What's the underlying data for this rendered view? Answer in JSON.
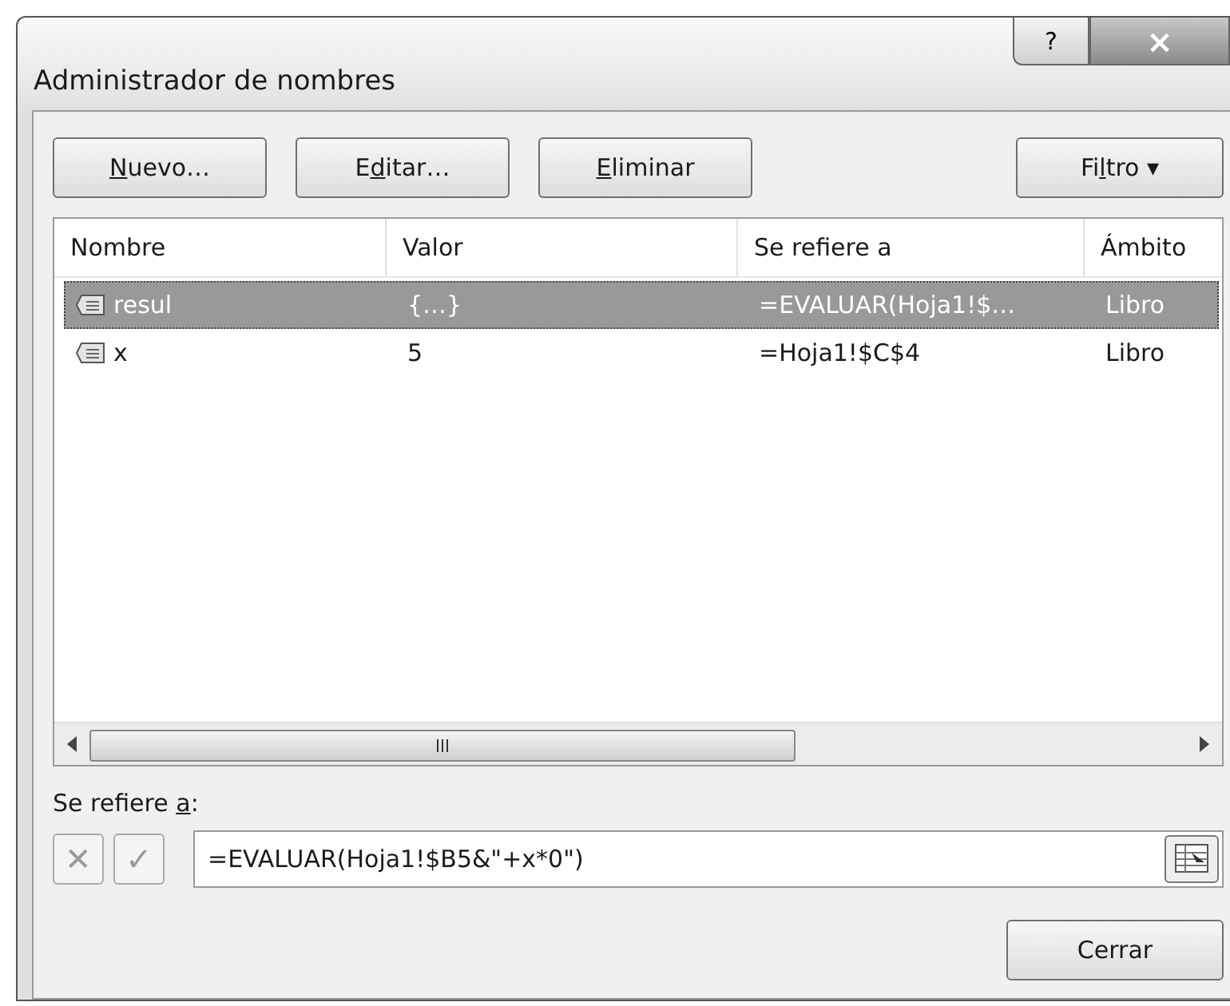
{
  "window": {
    "title": "Administrador de nombres",
    "help": "?",
    "close": "×"
  },
  "toolbar": [
    {
      "label": [
        {
          "text": "N",
          "underlined": true
        },
        {
          "text": "uevo…",
          "underlined": false
        }
      ]
    },
    {
      "label": [
        {
          "text": "E",
          "underlined": false
        },
        {
          "text": "d",
          "underlined": true
        },
        {
          "text": "itar…",
          "underlined": false
        }
      ]
    },
    {
      "label": [
        {
          "text": "E",
          "underlined": true
        },
        {
          "text": "liminar",
          "underlined": false
        }
      ]
    }
  ],
  "filter_button": {
    "label": [
      {
        "text": "Fi",
        "underlined": false
      },
      {
        "text": "l",
        "underlined": true
      },
      {
        "text": "tro",
        "underlined": false
      }
    ],
    "caret": "▾"
  },
  "table": {
    "columns": [
      "Nombre",
      "Valor",
      "Se refiere a",
      "Ámbito"
    ],
    "rows": [
      {
        "cells": [
          "resul",
          "{…}",
          "=EVALUAR(Hoja1!$…",
          "Libro"
        ],
        "selected": true
      },
      {
        "cells": [
          "x",
          "5",
          "=Hoja1!$C$4",
          "Libro"
        ],
        "selected": false
      }
    ]
  },
  "refers_to": {
    "label": [
      {
        "text": "Se refiere ",
        "underlined": false
      },
      {
        "text": "a",
        "underlined": true
      },
      {
        "text": ":",
        "underlined": false
      }
    ],
    "value": "=EVALUAR(Hoja1!$B5&\"+x*0\")",
    "cancel": "✕",
    "confirm": "✓"
  },
  "buttons": [
    {
      "label": "Cerrar"
    }
  ]
}
